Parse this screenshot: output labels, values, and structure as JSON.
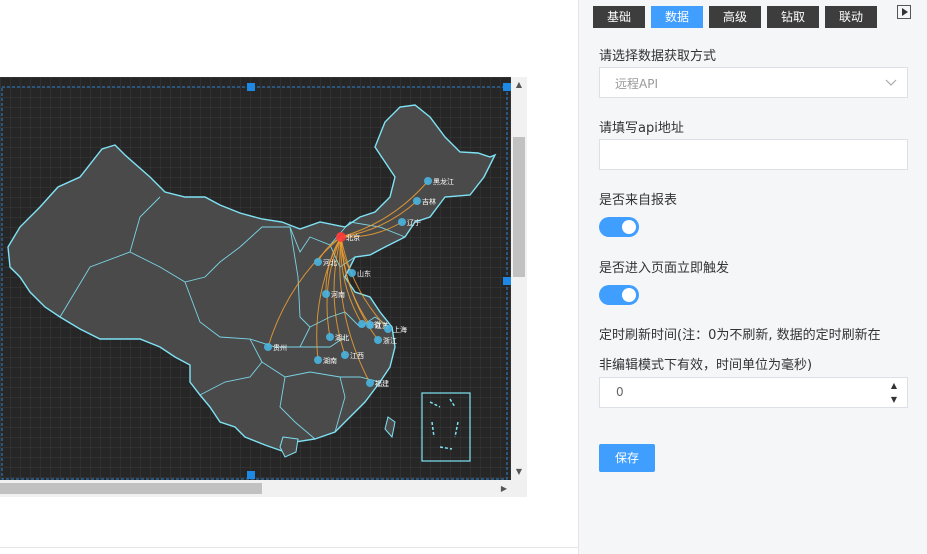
{
  "tabs": [
    {
      "label": "基础",
      "active": false
    },
    {
      "label": "数据",
      "active": true
    },
    {
      "label": "高级",
      "active": false
    },
    {
      "label": "钻取",
      "active": false
    },
    {
      "label": "联动",
      "active": false
    }
  ],
  "form": {
    "source_label": "请选择数据获取方式",
    "source_value": "远程API",
    "api_label": "请填写api地址",
    "api_value": "",
    "from_report_label": "是否来自报表",
    "from_report_on": true,
    "trigger_label": "是否进入页面立即触发",
    "trigger_on": true,
    "refresh_label_1": "定时刷新时间(注：0为不刷新, 数据的定时刷新在",
    "refresh_label_2": "非编辑模式下有效，时间单位为毫秒)",
    "refresh_value": "0",
    "save_label": "保存"
  },
  "map": {
    "city_labels": [
      "北京",
      "河北",
      "山东",
      "辽宁",
      "吉林",
      "黑龙江",
      "河南",
      "安徽",
      "江苏",
      "上海",
      "浙江",
      "湖北",
      "湖南",
      "江西",
      "福建",
      "贵州"
    ],
    "colors": {
      "background": "#262626",
      "province_fill": "#4a4a4a",
      "border": "#7fe3f5",
      "flow": "#f0a030",
      "origin": "#ff3b3b",
      "node": "#49b4e0"
    }
  },
  "colors": {
    "accent": "#409eff",
    "tab_inactive": "#3d3d3d"
  }
}
